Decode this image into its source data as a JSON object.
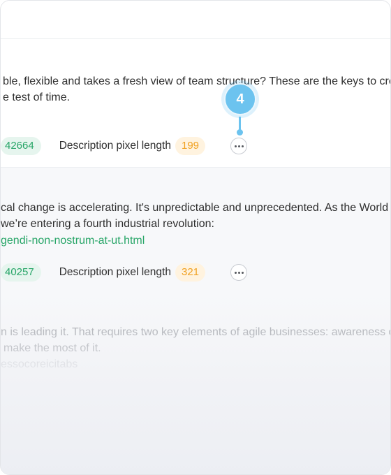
{
  "items": [
    {
      "text_lines": [
        "ble, flexible and takes a fresh view of team structure? These are the keys to creat",
        "e test of time."
      ],
      "count": "42664",
      "meta_label": "Description pixel length",
      "meta_value": "199"
    },
    {
      "text_lines": [
        "cal change is accelerating. It's unpredictable and unprecedented. As the World Ec",
        " we’re entering a fourth industrial revolution:"
      ],
      "link": "gendi-non-nostrum-at-ut.html",
      "count": "40257",
      "meta_label": "Description pixel length",
      "meta_value": "321"
    },
    {
      "text_lines": [
        "n is leading it. That requires two key elements of agile businesses: awareness of d",
        "make the most of it.",
        "essocoreicitabs"
      ]
    }
  ],
  "step_marker": "4",
  "colors": {
    "accent_green": "#27a567",
    "accent_orange": "#f0a020",
    "step_blue": "#6cc3ef"
  }
}
